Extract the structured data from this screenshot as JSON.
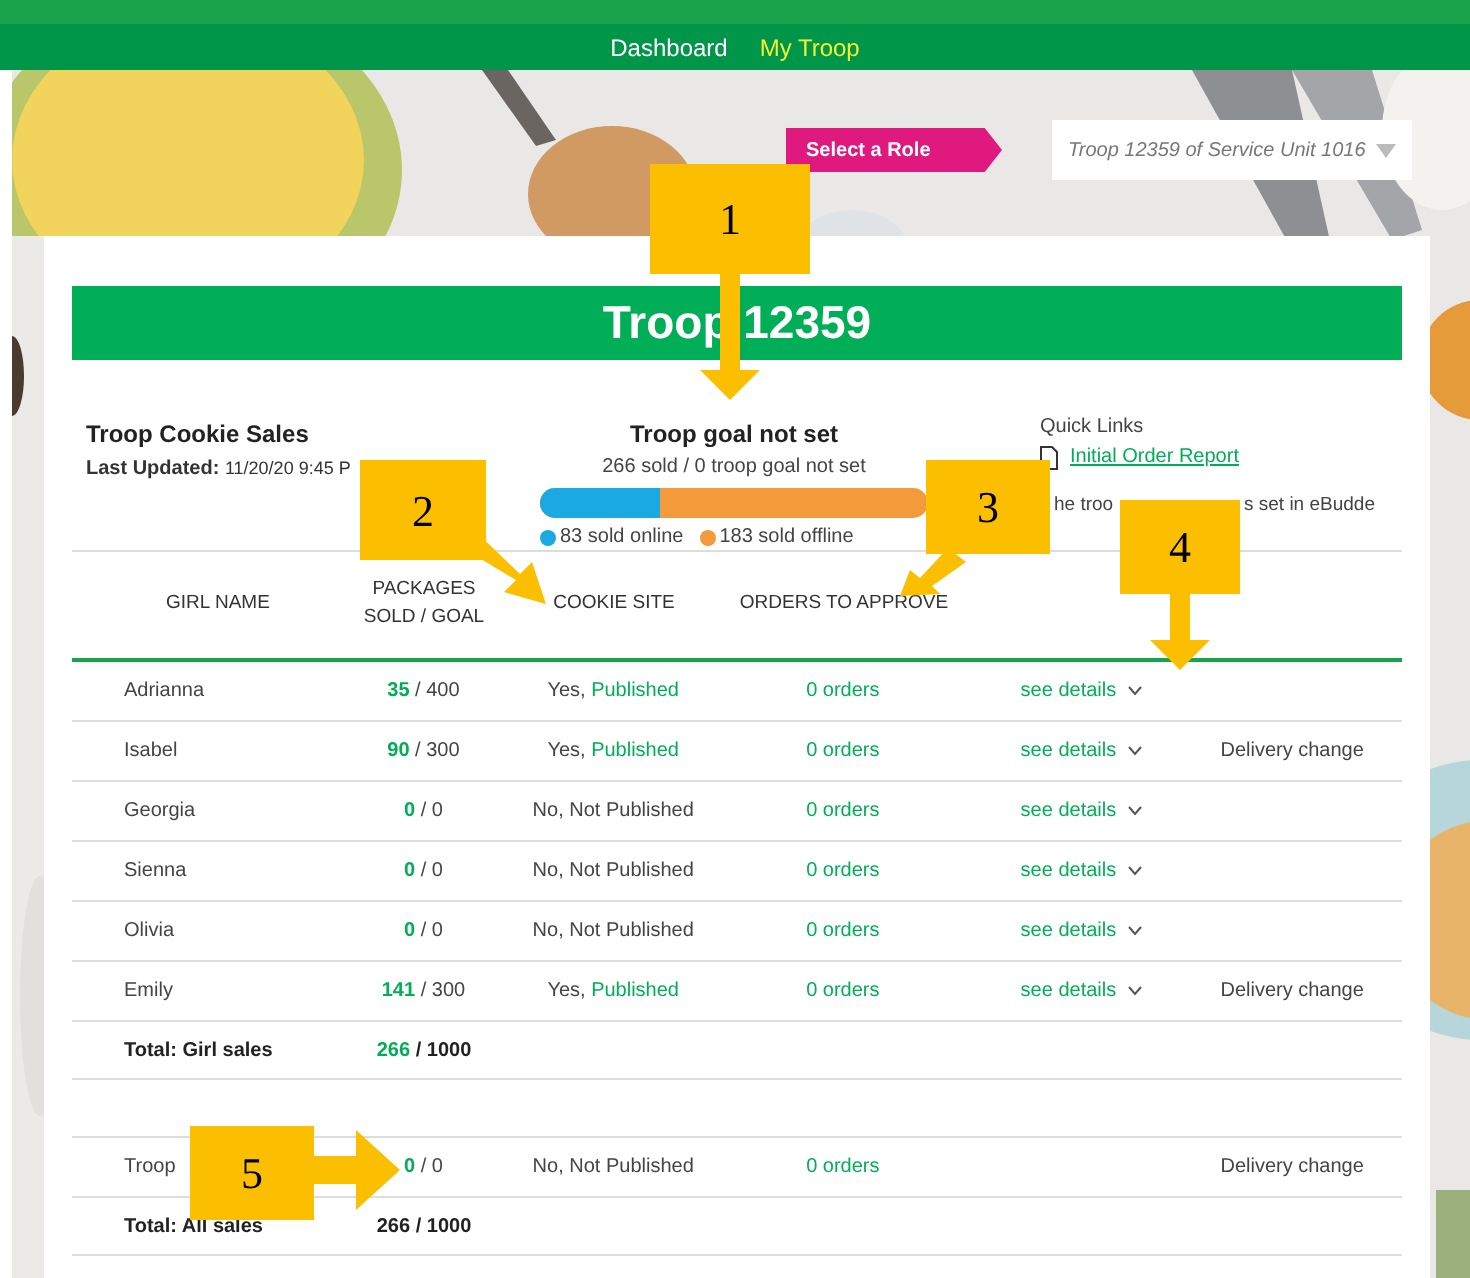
{
  "nav": [
    {
      "label": "Dashboard",
      "selected": false
    },
    {
      "label": "My Troop",
      "selected": true
    }
  ],
  "role": {
    "label": "Select a Role",
    "value": "Troop 12359 of Service Unit 1016"
  },
  "title": "Troop 12359",
  "summary": {
    "heading": "Troop Cookie Sales",
    "updated_label": "Last Updated:",
    "updated_value": "11/20/20 9:45 P"
  },
  "goal": {
    "heading": "Troop goal not set",
    "subtext": "266 sold / 0 troop goal not set",
    "level": 0.31,
    "legend": [
      {
        "label": "83 sold online",
        "color": "#1ba9e1"
      },
      {
        "label": "183 sold offline",
        "color": "#f39a3a"
      }
    ]
  },
  "quick_links": {
    "heading": "Quick Links",
    "link": "Initial Order Report",
    "note_parts": [
      "he troo",
      "s set in eBudde"
    ]
  },
  "table": {
    "columns": [
      "GIRL NAME",
      "PACKAGES SOLD / GOAL",
      "COOKIE SITE",
      "ORDERS TO APPROVE"
    ],
    "rows": [
      {
        "name": "Adrianna",
        "sold": "35",
        "goal": "/ 400",
        "site_answer": "Yes,",
        "site_status": "Published",
        "published": true,
        "orders": "0 orders",
        "details": "see details"
      },
      {
        "name": "Isabel",
        "sold": "90",
        "goal": "/ 300",
        "site_answer": "Yes,",
        "site_status": "Published",
        "published": true,
        "orders": "0 orders",
        "details": "see details",
        "note": "Delivery change"
      },
      {
        "name": "Georgia",
        "sold": "0",
        "goal": "/ 0",
        "site_answer": "No,",
        "site_status": "Not Published",
        "published": false,
        "orders": "0 orders",
        "details": "see details"
      },
      {
        "name": "Sienna",
        "sold": "0",
        "goal": "/ 0",
        "site_answer": "No,",
        "site_status": "Not Published",
        "published": false,
        "orders": "0 orders",
        "details": "see details"
      },
      {
        "name": "Olivia",
        "sold": "0",
        "goal": "/ 0",
        "site_answer": "No,",
        "site_status": "Not Published",
        "published": false,
        "orders": "0 orders",
        "details": "see details"
      },
      {
        "name": "Emily",
        "sold": "141",
        "goal": "/ 300",
        "site_answer": "Yes,",
        "site_status": "Published",
        "published": true,
        "orders": "0 orders",
        "details": "see details",
        "note": "Delivery change"
      }
    ],
    "girl_total": {
      "label": "Total: Girl sales",
      "sold": "266",
      "goal": "/ 1000"
    },
    "troop_row": {
      "name": "Troop",
      "sold": "0",
      "goal": "/ 0",
      "site_answer": "No,",
      "site_status": "Not Published",
      "published": false,
      "orders": "0 orders",
      "note": "Delivery change"
    },
    "all_total": {
      "label": "Total: All sales",
      "value": "266 / 1000"
    }
  },
  "callouts": [
    {
      "number": "1"
    },
    {
      "number": "2"
    },
    {
      "number": "3"
    },
    {
      "number": "4"
    },
    {
      "number": "5"
    }
  ]
}
